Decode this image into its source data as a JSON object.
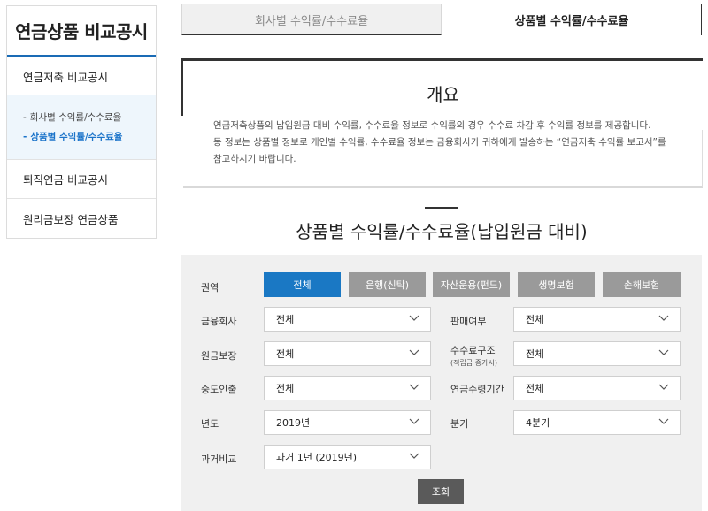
{
  "sidebar": {
    "title": "연금상품 비교공시",
    "items": [
      {
        "label": "연금저축 비교공시"
      },
      {
        "label": "퇴직연금 비교공시"
      },
      {
        "label": "원리금보장 연금상품"
      }
    ],
    "subitems": [
      {
        "dash": "-",
        "label": "회사별 수익률/수수료율"
      },
      {
        "dash": "-",
        "label": "상품별 수익률/수수료율"
      }
    ]
  },
  "tabs": [
    {
      "label": "회사별 수익률/수수료율",
      "active": false
    },
    {
      "label": "상품별 수익률/수수료율",
      "active": true
    }
  ],
  "overview": {
    "title": "개요",
    "lines": [
      "연금저축상품의 납입원금 대비 수익률, 수수료율 정보로 수익률의 경우 수수료 차감 후 수익률 정보를 제공합니다.",
      "동 정보는 상품별 정보로 개인별 수익률, 수수료율 정보는 금융회사가 귀하에게 발송하는 “연금저축 수익률 보고서”를",
      "참고하시기 바랍니다."
    ]
  },
  "section_title": "상품별 수익률/수수료율(납입원금 대비)",
  "filters": {
    "region_label": "권역",
    "region_buttons": [
      "전체",
      "은행(신탁)",
      "자산운용(펀드)",
      "생명보험",
      "손해보험"
    ],
    "financial_company": {
      "label": "금융회사",
      "value": "전체"
    },
    "sales_status": {
      "label": "판매여부",
      "value": "전체"
    },
    "principal_guarantee": {
      "label": "원금보장",
      "value": "전체"
    },
    "fee_structure": {
      "label": "수수료구조",
      "sublabel": "(적립금 증가시)",
      "value": "전체"
    },
    "early_withdrawal": {
      "label": "중도인출",
      "value": "전체"
    },
    "pension_period": {
      "label": "연금수령기간",
      "value": "전체"
    },
    "year": {
      "label": "년도",
      "value": "2019년"
    },
    "quarter": {
      "label": "분기",
      "value": "4분기"
    },
    "past_compare": {
      "label": "과거비교",
      "value": "과거 1년 (2019년)"
    },
    "search_label": "조회"
  },
  "colors": {
    "accent": "#1a78c4",
    "button_gray": "#9a9a9a",
    "search_button": "#5a5a5a"
  }
}
